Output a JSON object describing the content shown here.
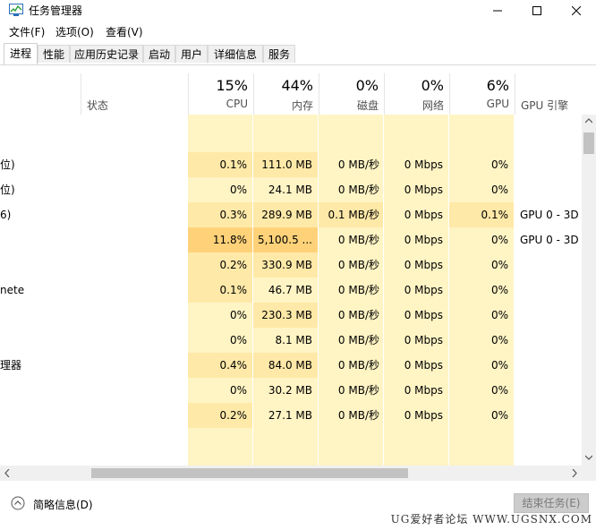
{
  "window": {
    "title": "任务管理器"
  },
  "menu": {
    "items": [
      "文件(F)",
      "选项(O)",
      "查看(V)"
    ]
  },
  "tabs": [
    "进程",
    "性能",
    "应用历史记录",
    "启动",
    "用户",
    "详细信息",
    "服务"
  ],
  "header": {
    "status_label": "状态",
    "cpu_pct": "15%",
    "cpu_label": "CPU",
    "mem_pct": "44%",
    "mem_label": "内存",
    "disk_pct": "0%",
    "disk_label": "磁盘",
    "net_pct": "0%",
    "net_label": "网络",
    "gpu_pct": "6%",
    "gpu_label": "GPU",
    "gpu_engine_label": "GPU 引擎"
  },
  "rows": [
    {
      "name": "",
      "cpu": "",
      "mem": "",
      "disk": "",
      "net": "",
      "gpu": "",
      "engine": ""
    },
    {
      "name": "位)",
      "cpu": "0.1%",
      "mem": "111.0 MB",
      "disk": "0 MB/秒",
      "net": "0 Mbps",
      "gpu": "0%",
      "engine": ""
    },
    {
      "name": "位)",
      "cpu": "0%",
      "mem": "24.1 MB",
      "disk": "0 MB/秒",
      "net": "0 Mbps",
      "gpu": "0%",
      "engine": ""
    },
    {
      "name": "6)",
      "cpu": "0.3%",
      "mem": "289.9 MB",
      "disk": "0.1 MB/秒",
      "net": "0 Mbps",
      "gpu": "0.1%",
      "engine": "GPU 0 - 3D"
    },
    {
      "name": "",
      "cpu": "11.8%",
      "mem": "5,100.5 ...",
      "disk": "0 MB/秒",
      "net": "0 Mbps",
      "gpu": "0%",
      "engine": "GPU 0 - 3D"
    },
    {
      "name": "",
      "cpu": "0.2%",
      "mem": "330.9 MB",
      "disk": "0 MB/秒",
      "net": "0 Mbps",
      "gpu": "0%",
      "engine": ""
    },
    {
      "name": "nete",
      "cpu": "0.1%",
      "mem": "46.7 MB",
      "disk": "0 MB/秒",
      "net": "0 Mbps",
      "gpu": "0%",
      "engine": ""
    },
    {
      "name": "",
      "cpu": "0%",
      "mem": "230.3 MB",
      "disk": "0 MB/秒",
      "net": "0 Mbps",
      "gpu": "0%",
      "engine": ""
    },
    {
      "name": "",
      "cpu": "0%",
      "mem": "8.1 MB",
      "disk": "0 MB/秒",
      "net": "0 Mbps",
      "gpu": "0%",
      "engine": ""
    },
    {
      "name": "理器",
      "cpu": "0.4%",
      "mem": "84.0 MB",
      "disk": "0 MB/秒",
      "net": "0 Mbps",
      "gpu": "0%",
      "engine": ""
    },
    {
      "name": "",
      "cpu": "0%",
      "mem": "30.2 MB",
      "disk": "0 MB/秒",
      "net": "0 Mbps",
      "gpu": "0%",
      "engine": ""
    },
    {
      "name": "",
      "cpu": "0.2%",
      "mem": "27.1 MB",
      "disk": "0 MB/秒",
      "net": "0 Mbps",
      "gpu": "0%",
      "engine": ""
    }
  ],
  "footer": {
    "fewer_details": "简略信息(D)",
    "end_task": "结束任务(E)",
    "watermark": "UG爱好者论坛 WWW.UGSNX.COM"
  },
  "colors": {
    "heat_light": "#fff4c4",
    "heat_mid": "#ffe9a8",
    "heat_strong": "#ffd27a",
    "header_bg": "#fff4c4"
  }
}
